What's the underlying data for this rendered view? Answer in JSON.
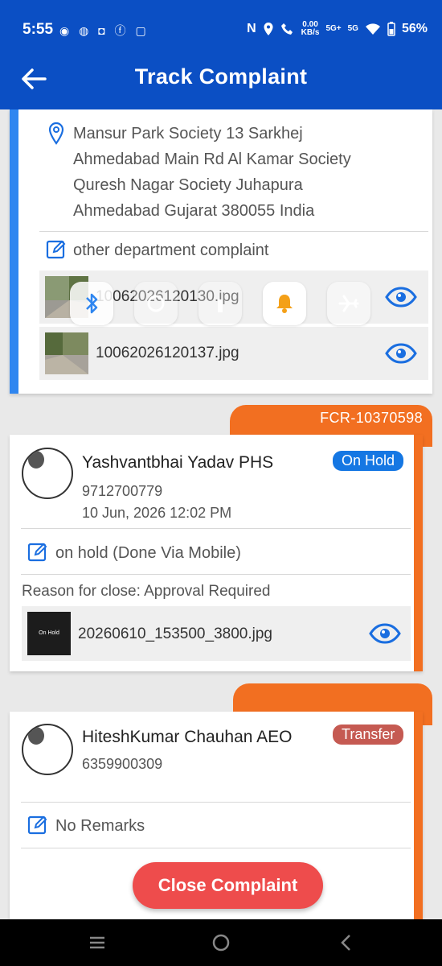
{
  "status_bar": {
    "time": "5:55",
    "app_icons": "◉ ◍ ◘ ⓕ ▢",
    "speed_value": "0.00",
    "speed_unit": "KB/s",
    "network_1": "5G+",
    "network_2": "5G",
    "battery": "56%"
  },
  "app_bar": {
    "title": "Track Complaint"
  },
  "address_card": {
    "address_lines": [
      "Mansur Park Society  13  Sarkhej",
      "Ahmedabad Main Rd  Al Kamar Society",
      "Quresh Nagar Society  Juhapura",
      "Ahmedabad  Gujarat 380055  India"
    ],
    "remark": "other department complaint",
    "files": [
      "10062026120130.jpg",
      "10062026120137.jpg"
    ]
  },
  "history": [
    {
      "tab_label": "FCR-10370598",
      "name": "Yashvantbhai Yadav PHS",
      "phone": "9712700779",
      "date": "10 Jun, 2026 12:02 PM",
      "status": "On Hold",
      "remark": "on hold (Done Via Mobile)",
      "reason": "Reason for close: Approval Required",
      "file": "20260610_153500_3800.jpg",
      "thumb_text": "On Hold"
    },
    {
      "tab_label": "",
      "name": "HiteshKumar Chauhan AEO",
      "phone": "6359900309",
      "status": "Transfer",
      "remark": "No Remarks"
    }
  ],
  "close_button": "Close Complaint",
  "colors": {
    "primary": "#0b4fc4",
    "accent_orange": "#f26f21",
    "on_hold": "#1577e3",
    "transfer": "#c55a52",
    "close": "#ee4c4c"
  }
}
